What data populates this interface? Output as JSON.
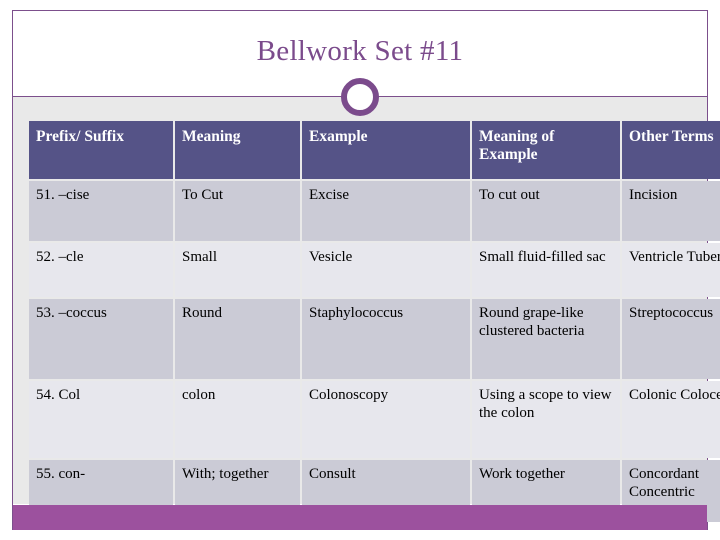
{
  "slide": {
    "title": "Bellwork Set #11",
    "ornament_icon": "ring-ornament",
    "colors": {
      "title_purple": "#7b4b8c",
      "header_slate": "#555387",
      "row_odd": "#cbcbd6",
      "row_even": "#e7e7ed",
      "bottom_bar_purple": "#9c519e",
      "panel_gray": "#e9e9e9"
    }
  },
  "table": {
    "headers": [
      "Prefix/ Suffix",
      "Meaning",
      "Example",
      "Meaning of Example",
      "Other Terms"
    ],
    "rows": [
      {
        "prefix_suffix": "51. –cise",
        "meaning": "To Cut",
        "example": "Excise",
        "meaning_of_example": "To cut out",
        "other_terms": "Incision"
      },
      {
        "prefix_suffix": "52. –cle",
        "meaning": "Small",
        "example": "Vesicle",
        "meaning_of_example": "Small fluid-filled sac",
        "other_terms": "Ventricle Tubercle"
      },
      {
        "prefix_suffix": "53. –coccus",
        "meaning": "Round",
        "example": "Staphylococcus",
        "meaning_of_example": "Round grape-like clustered bacteria",
        "other_terms": "Streptococcus"
      },
      {
        "prefix_suffix": "54. Col",
        "meaning": "colon",
        "example": "Colonoscopy",
        "meaning_of_example": "Using a scope to view the colon",
        "other_terms": "Colonic Colocentesis"
      },
      {
        "prefix_suffix": "55. con-",
        "meaning": "With; together",
        "example": "Consult",
        "meaning_of_example": "Work together",
        "other_terms": "Concordant Concentric"
      }
    ]
  }
}
